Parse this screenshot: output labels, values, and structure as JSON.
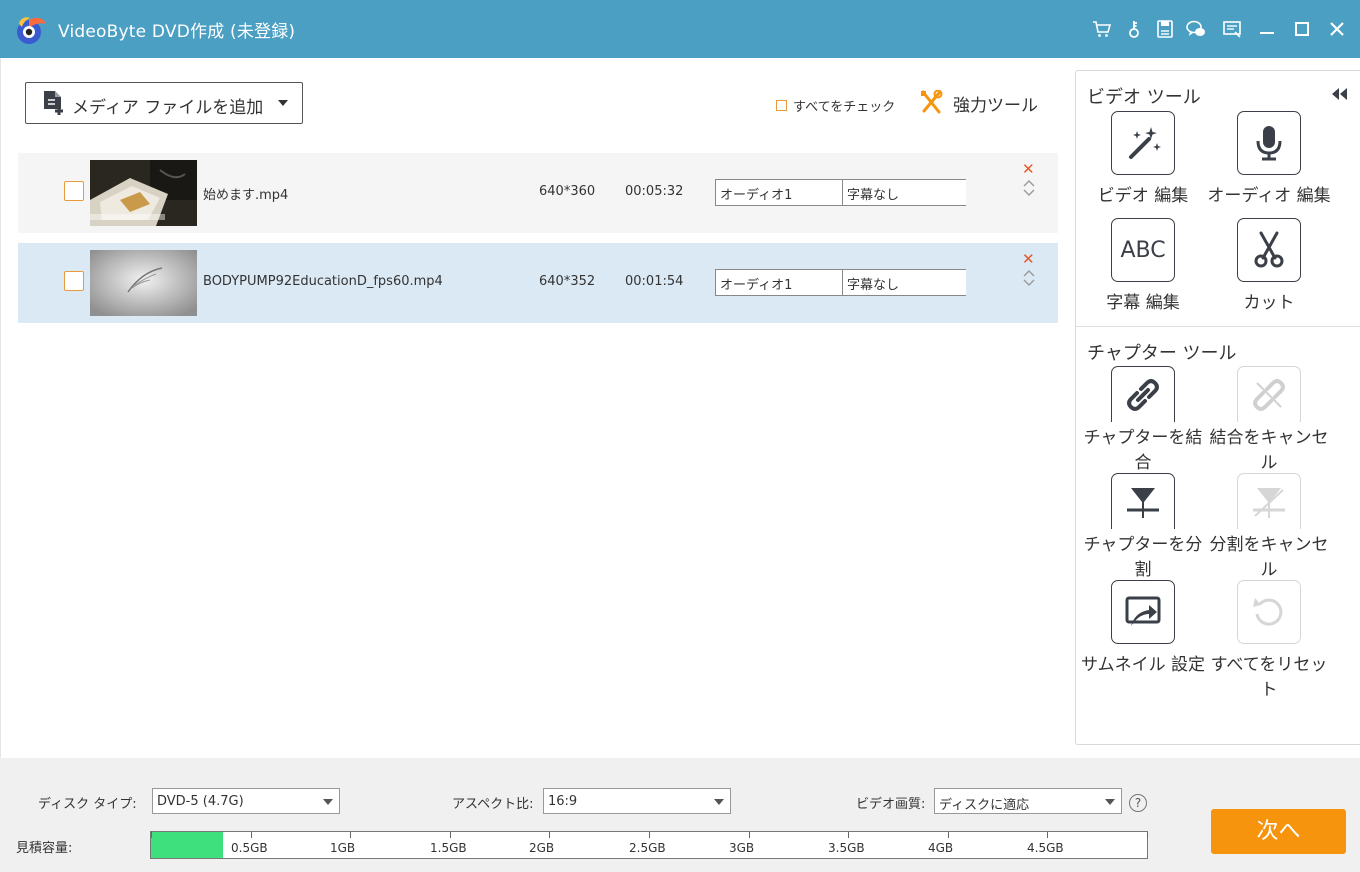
{
  "titlebar": {
    "title": "VideoByte DVD作成 (未登録)",
    "icons": [
      "cart-icon",
      "key-icon",
      "save-icon",
      "chat-icon",
      "feedback-icon",
      "minimize-icon",
      "maximize-icon",
      "close-icon"
    ]
  },
  "toolbar": {
    "add_media_label": "メディア ファイルを追加",
    "check_all_label": "すべてをチェック",
    "power_tools_label": "強力ツール"
  },
  "files": [
    {
      "name": "始めます.mp4",
      "resolution": "640*360",
      "duration": "00:05:32",
      "audio": "オーディオ1",
      "subtitle": "字幕なし",
      "selected": false
    },
    {
      "name": "BODYPUMP92EducationD_fps60.mp4",
      "resolution": "640*352",
      "duration": "00:01:54",
      "audio": "オーディオ1",
      "subtitle": "字幕なし",
      "selected": true
    }
  ],
  "panel": {
    "video_tools_title": "ビデオ ツール",
    "video_tools": [
      {
        "label": "ビデオ 編集",
        "icon": "magic-wand-icon"
      },
      {
        "label": "オーディオ 編集",
        "icon": "microphone-icon"
      },
      {
        "label": "字幕 編集",
        "icon": "abc-icon"
      },
      {
        "label": "カット",
        "icon": "scissors-icon"
      }
    ],
    "chapter_tools_title": "チャプター ツール",
    "chapter_tools": [
      {
        "label": "チャプターを結合",
        "icon": "link-icon",
        "enabled": true
      },
      {
        "label": "結合をキャンセル",
        "icon": "unlink-icon",
        "enabled": false
      },
      {
        "label": "チャプターを分割",
        "icon": "split-icon",
        "enabled": true
      },
      {
        "label": "分割をキャンセル",
        "icon": "cancel-split-icon",
        "enabled": false
      },
      {
        "label": "サムネイル 設定",
        "icon": "thumbnail-icon",
        "enabled": true
      },
      {
        "label": "すべてをリセット",
        "icon": "reset-icon",
        "enabled": false
      }
    ]
  },
  "bottom": {
    "disc_type_label": "ディスク タイプ:",
    "disc_type_value": "DVD-5 (4.7G)",
    "aspect_label": "アスペクト比:",
    "aspect_value": "16:9",
    "quality_label": "ビデオ画質:",
    "quality_value": "ディスクに適応",
    "help_text": "?",
    "capacity_label": "見積容量:",
    "capacity_ticks": [
      "0.5GB",
      "1GB",
      "1.5GB",
      "2GB",
      "2.5GB",
      "3GB",
      "3.5GB",
      "4GB",
      "4.5GB"
    ],
    "capacity_used_fraction": 0.072,
    "next_label": "次へ"
  },
  "colors": {
    "titlebar": "#4a9fc3",
    "accent_orange": "#f6940e",
    "capacity_green": "#3ee07e",
    "selected_row": "#dbe9f5",
    "delete_red": "#e45a2b"
  }
}
